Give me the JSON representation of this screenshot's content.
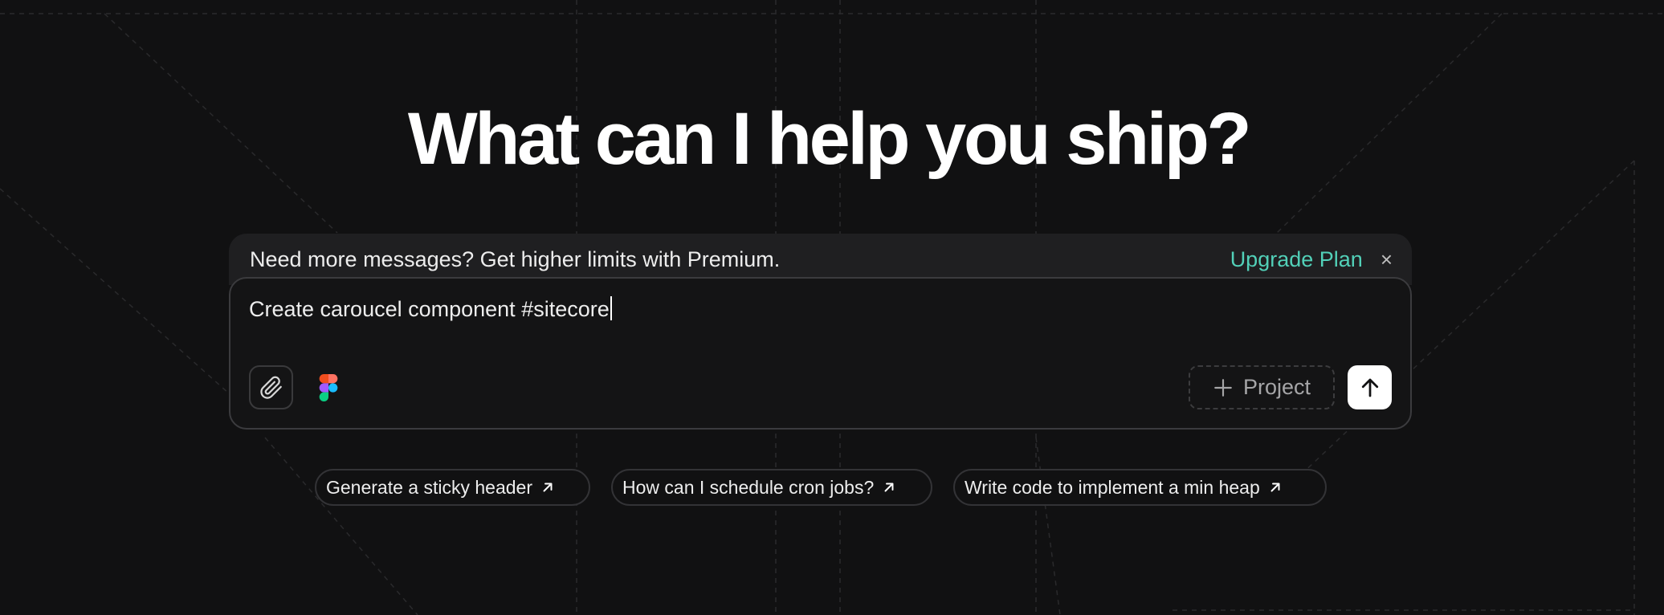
{
  "hero": {
    "title": "What can I help you ship?"
  },
  "banner": {
    "text": "Need more messages? Get higher limits with Premium.",
    "upgrade_label": "Upgrade Plan",
    "close_label": "×"
  },
  "composer": {
    "input_value": "Create caroucel component #sitecore",
    "project_label": "Project",
    "attach_icon": "paperclip-icon",
    "figma_icon": "figma-icon",
    "send_icon": "arrow-up-icon"
  },
  "suggestions": [
    {
      "label": "Generate a sticky header",
      "icon": "arrow-up-right-icon"
    },
    {
      "label": "How can I schedule cron jobs?",
      "icon": "arrow-up-right-icon"
    },
    {
      "label": "Write code to implement a min heap",
      "icon": "arrow-up-right-icon"
    }
  ],
  "colors": {
    "background": "#111112",
    "accent": "#52d0b8",
    "banner": "#1f1f21",
    "border": "#3b3b3e"
  }
}
